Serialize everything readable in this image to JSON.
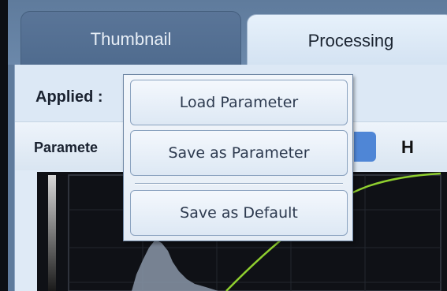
{
  "tabs": [
    {
      "label": "Thumbnail",
      "active": false
    },
    {
      "label": "Processing",
      "active": true
    }
  ],
  "applied": {
    "label": "Applied :"
  },
  "parameter": {
    "label": "Paramete",
    "h_label": "H"
  },
  "context_menu": {
    "items": [
      {
        "label": "Load Parameter"
      },
      {
        "label": "Save as Parameter"
      },
      {
        "label": "Save as Default"
      }
    ]
  },
  "colors": {
    "tab_strip": "#5f7b9c",
    "panel_bg": "#dfeaf6",
    "graph_bg": "#0f1116",
    "curve": "#8fcf2f",
    "histogram": "#8a96a8",
    "accent_blue": "#4f86d6"
  }
}
